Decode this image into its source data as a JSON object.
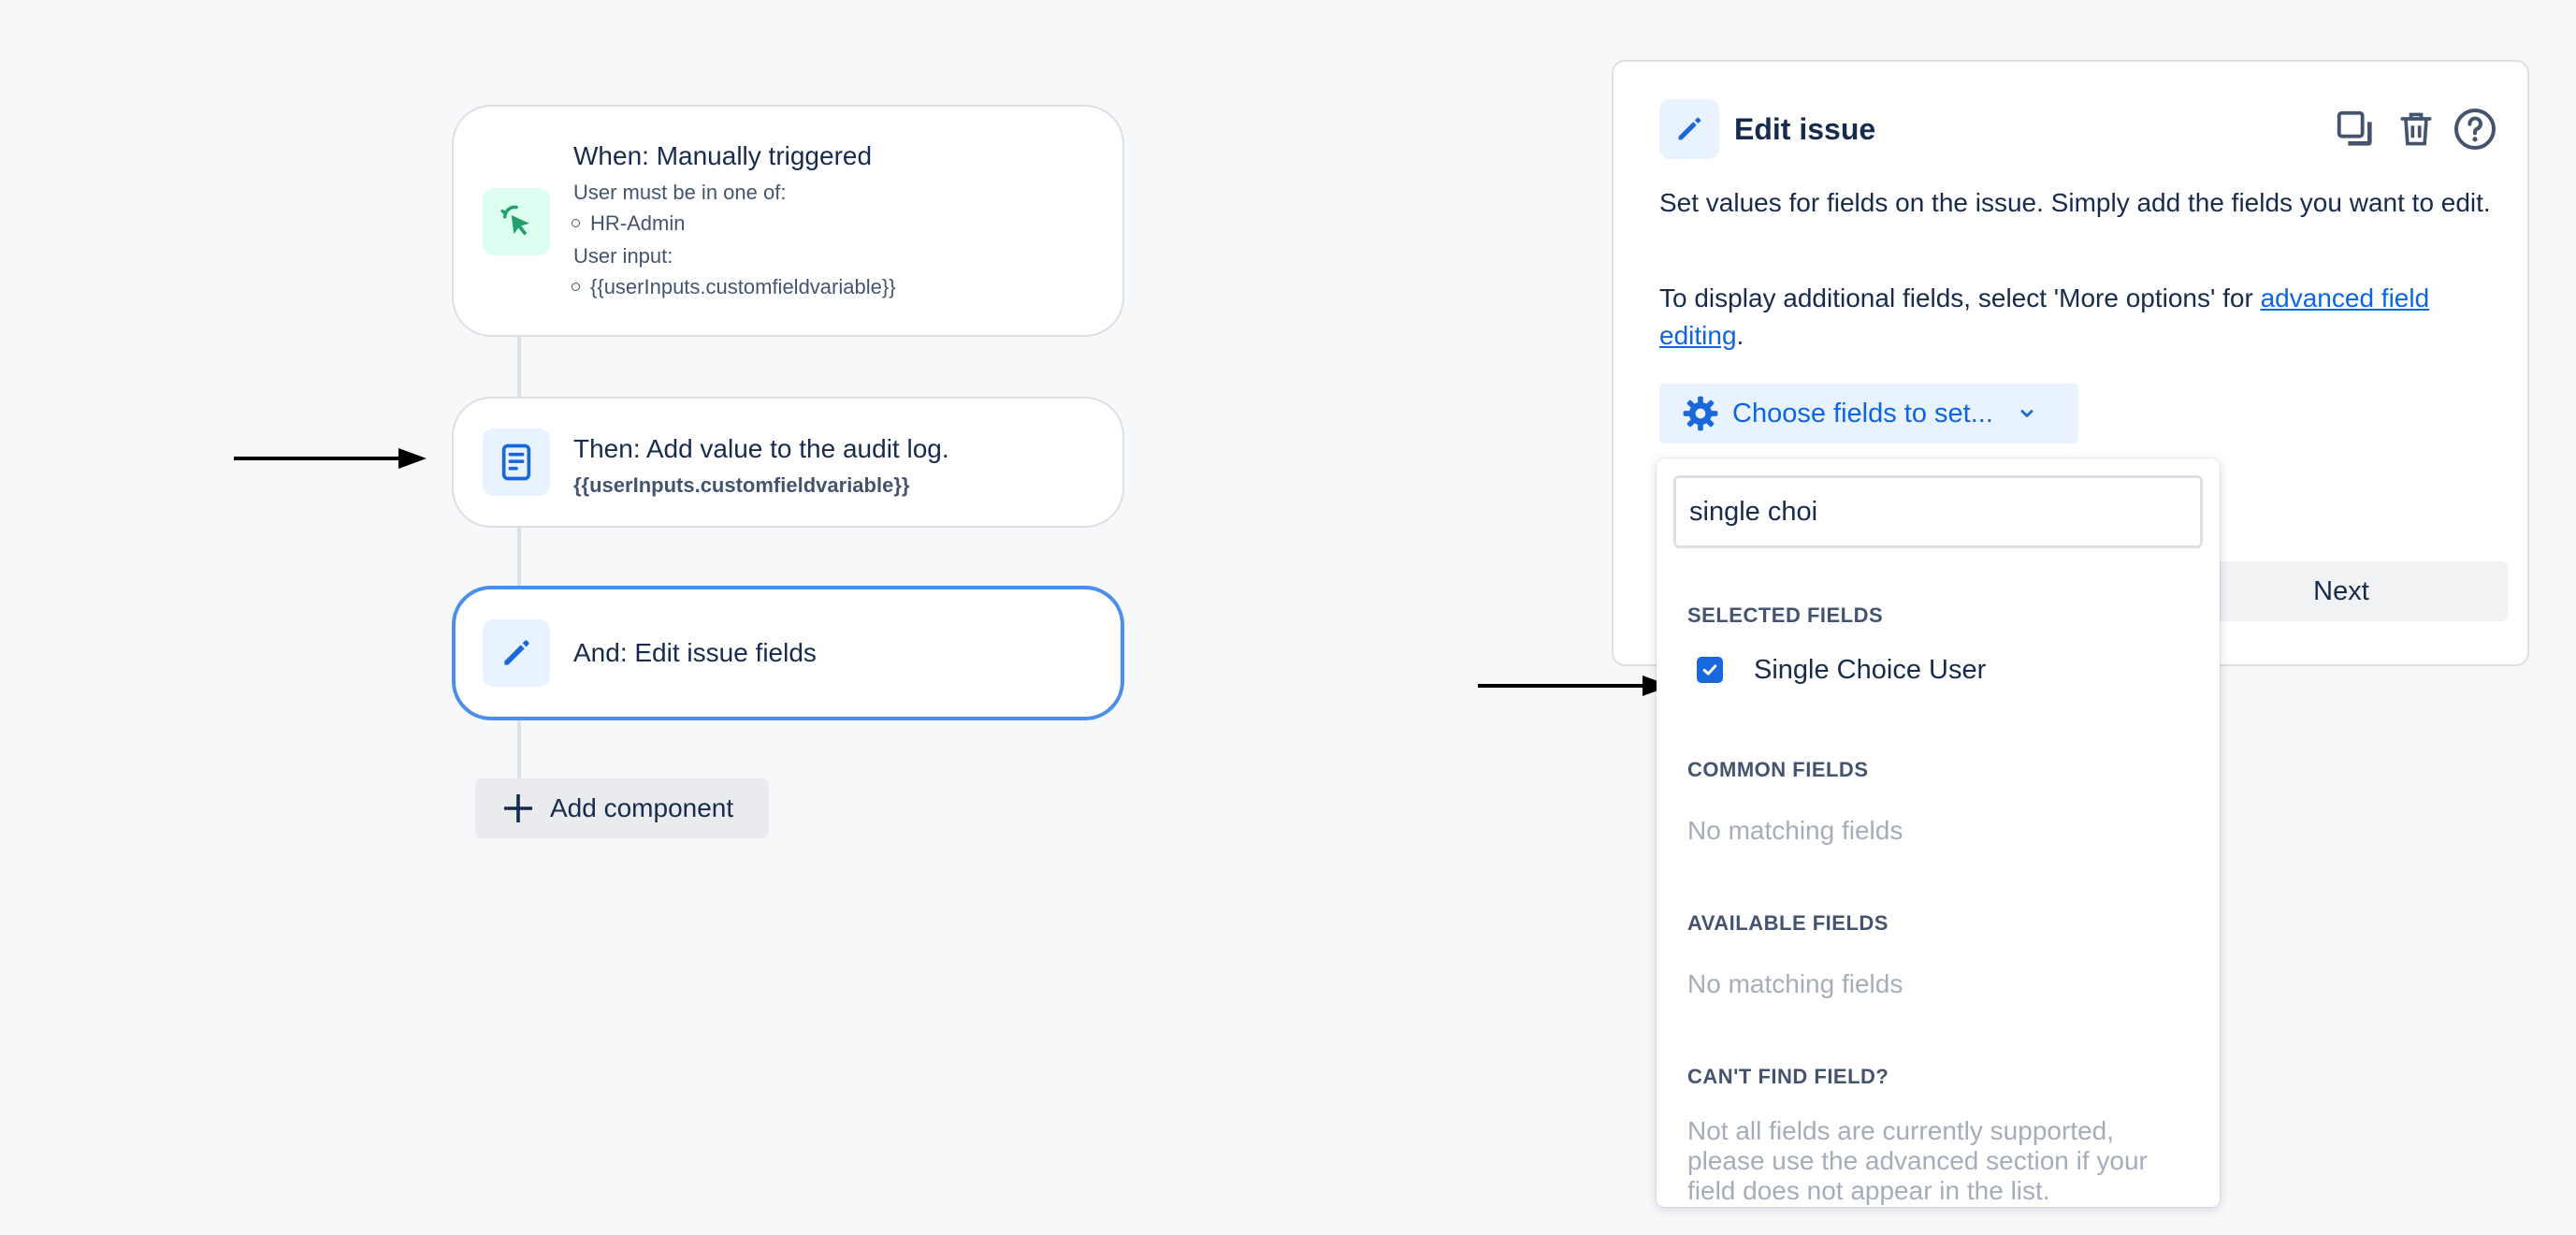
{
  "flow": {
    "trigger": {
      "title": "When: Manually triggered",
      "line1": "User must be in one of:",
      "bullet1": "HR-Admin",
      "line2": "User input:",
      "bullet2": "{{userInputs.customfieldvariable}}"
    },
    "action1": {
      "title": "Then: Add value to the audit log.",
      "value": "{{userInputs.customfieldvariable}}"
    },
    "action2": {
      "title": "And: Edit issue fields"
    },
    "add_component_label": "Add component"
  },
  "panel": {
    "title": "Edit issue",
    "description": "Set values for fields on the issue. Simply add the fields you want to edit.",
    "hint_prefix": "To display additional fields, select 'More options' for ",
    "hint_link": "advanced field editing",
    "hint_suffix": ".",
    "choose_fields_label": "Choose fields to set...",
    "next_label": "Next"
  },
  "dropdown": {
    "search_value": "single choi",
    "selected_heading": "SELECTED FIELDS",
    "selected_items": [
      {
        "label": "Single Choice User",
        "checked": true
      }
    ],
    "common_heading": "COMMON FIELDS",
    "common_empty": "No matching fields",
    "available_heading": "AVAILABLE FIELDS",
    "available_empty": "No matching fields",
    "cant_find_heading": "CAN'T FIND FIELD?",
    "cant_find_text": "Not all fields are currently supported, please use the advanced section if your field does not appear in the list."
  },
  "colors": {
    "accent": "#0c66e4",
    "selected_border": "#4c8ee8",
    "trigger_icon": "#22a06b",
    "checkbox": "#1868db"
  },
  "icons": {
    "trigger": "cursor-click-icon",
    "audit_log": "document-icon",
    "edit": "pencil-icon",
    "add": "plus-icon",
    "duplicate": "duplicate-icon",
    "delete": "trash-icon",
    "help": "help-icon",
    "settings": "gear-icon",
    "chevron": "chevron-down-icon",
    "check": "check-icon"
  }
}
